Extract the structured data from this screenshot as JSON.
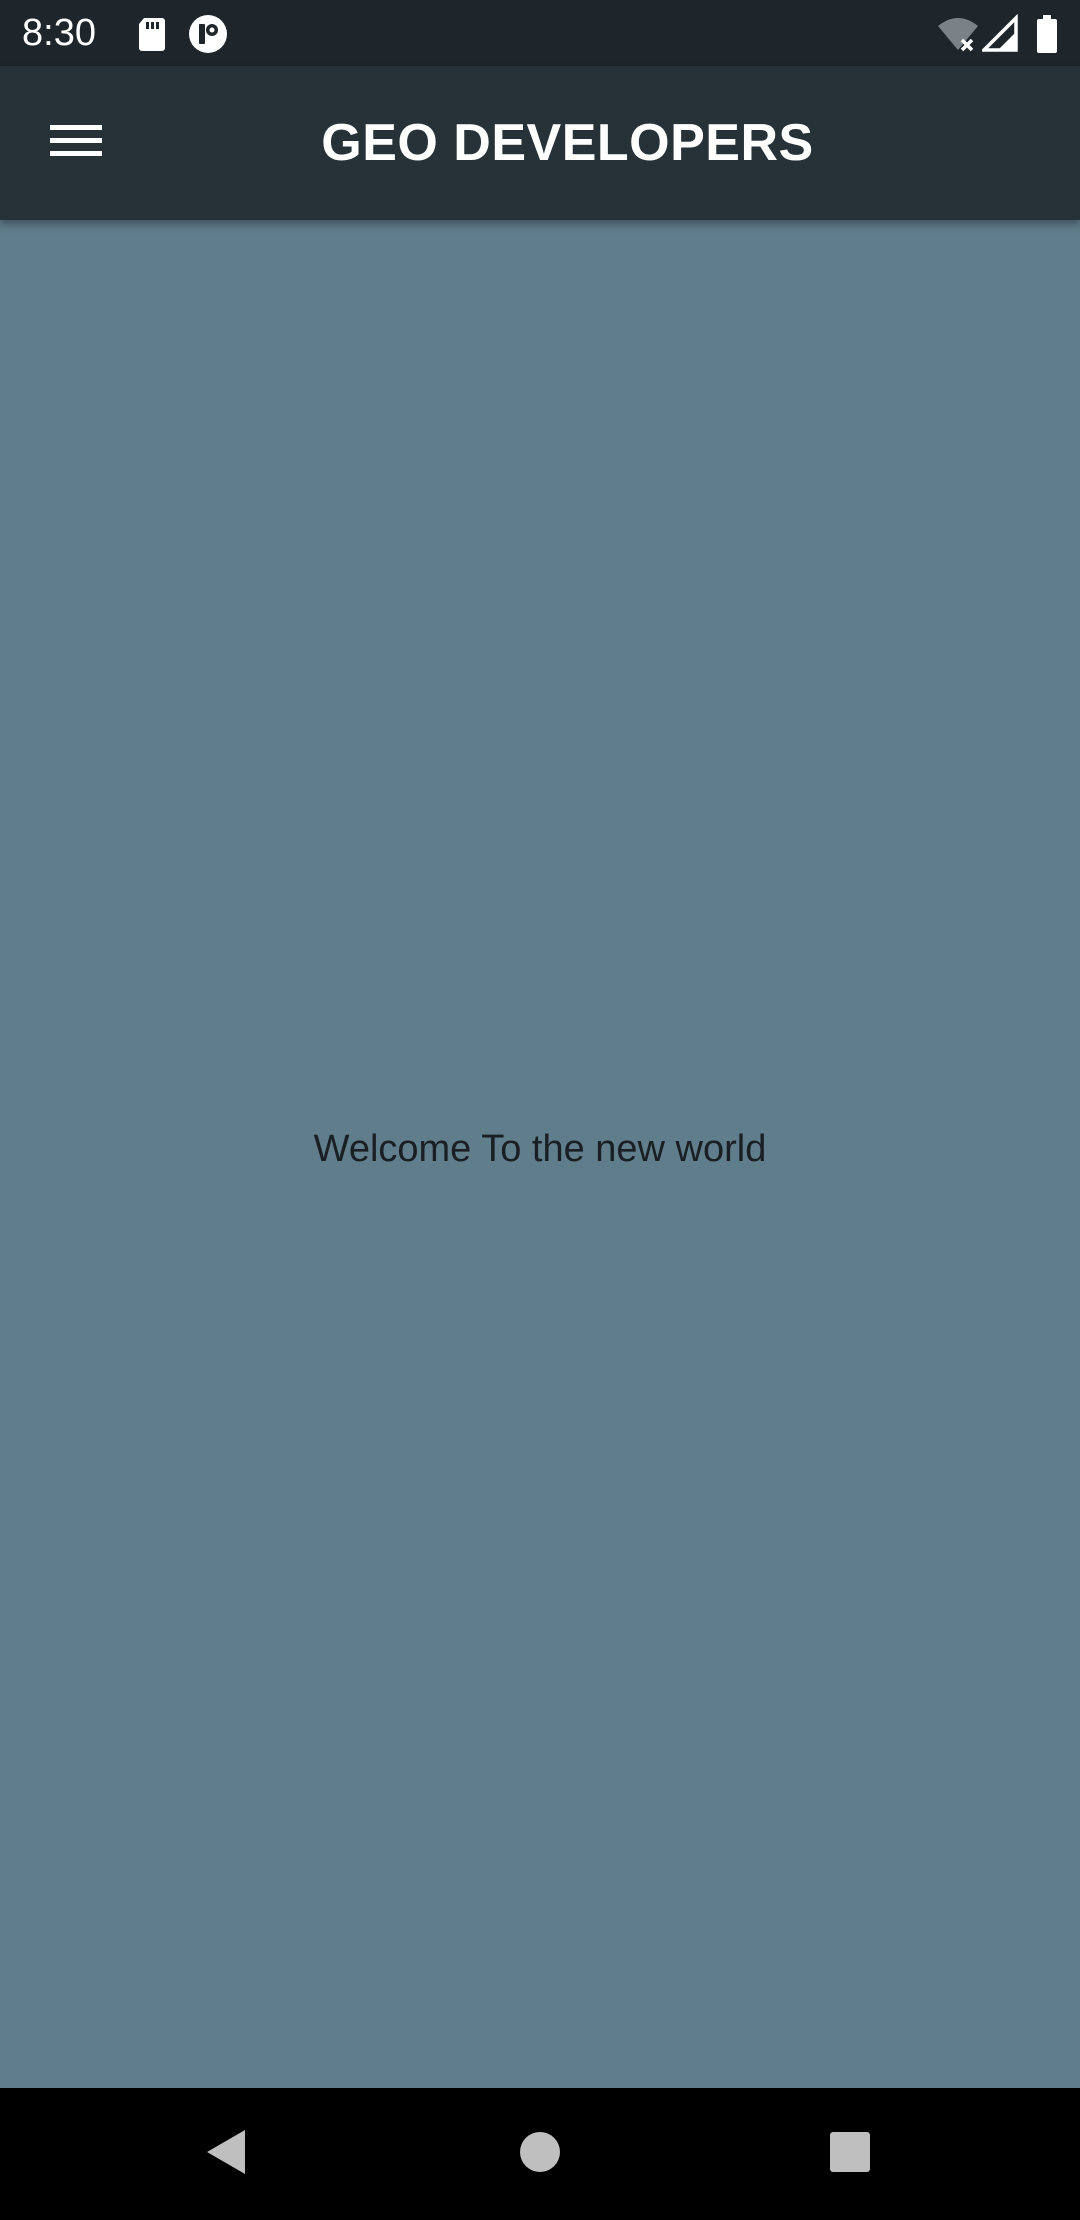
{
  "status_bar": {
    "time": "8:30",
    "icons": [
      "sd-card-icon",
      "app-notification-icon",
      "wifi-off-icon",
      "signal-icon",
      "battery-icon"
    ]
  },
  "app_bar": {
    "title": "GEO DEVELOPERS",
    "menu_icon": "hamburger-menu-icon"
  },
  "main": {
    "welcome_text": "Welcome To the new world"
  },
  "nav_bar": {
    "buttons": [
      "back-icon",
      "home-icon",
      "recents-icon"
    ]
  },
  "colors": {
    "status_bar": "#1e262b",
    "app_bar": "#263238",
    "content_background": "#607d8b",
    "nav_bar": "#000000",
    "text_dark": "#1a1f24"
  }
}
